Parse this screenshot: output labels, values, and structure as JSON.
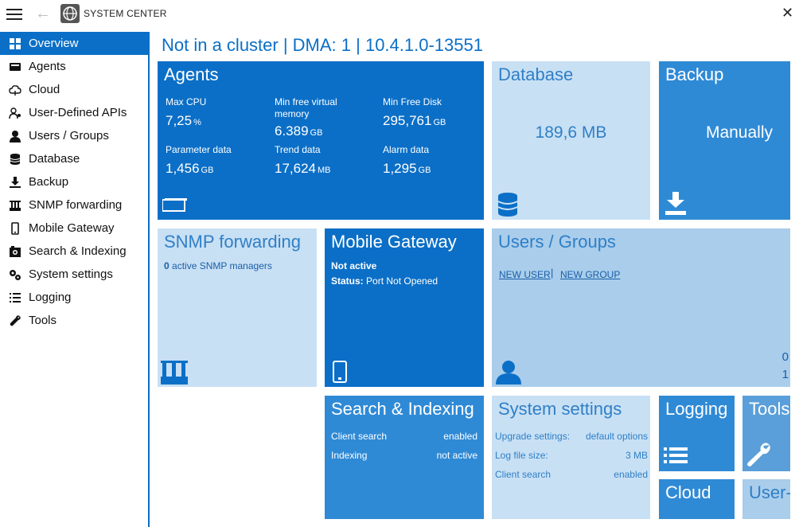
{
  "app": {
    "title": "SYSTEM CENTER"
  },
  "header": {
    "title": "Not in a cluster | DMA: 1 | 10.4.1.0-13551"
  },
  "sidebar": {
    "items": [
      {
        "label": "Overview",
        "icon": "grid-icon"
      },
      {
        "label": "Agents",
        "icon": "agent-icon"
      },
      {
        "label": "Cloud",
        "icon": "cloud-icon"
      },
      {
        "label": "User-Defined APIs",
        "icon": "api-icon"
      },
      {
        "label": "Users / Groups",
        "icon": "user-icon"
      },
      {
        "label": "Database",
        "icon": "database-icon"
      },
      {
        "label": "Backup",
        "icon": "download-icon"
      },
      {
        "label": "SNMP forwarding",
        "icon": "snmp-icon"
      },
      {
        "label": "Mobile Gateway",
        "icon": "phone-icon"
      },
      {
        "label": "Search & Indexing",
        "icon": "search-index-icon"
      },
      {
        "label": "System settings",
        "icon": "gears-icon"
      },
      {
        "label": "Logging",
        "icon": "list-icon"
      },
      {
        "label": "Tools",
        "icon": "wrench-icon"
      }
    ]
  },
  "tiles": {
    "agents": {
      "title": "Agents",
      "max_cpu_label": "Max CPU",
      "max_cpu_value": "7,25",
      "max_cpu_unit": "%",
      "min_vmem_label": "Min free virtual memory",
      "min_vmem_value": "6.389",
      "min_vmem_unit": "GB",
      "min_disk_label": "Min Free Disk",
      "min_disk_value": "295,761",
      "min_disk_unit": "GB",
      "param_label": "Parameter data",
      "param_value": "1,456",
      "param_unit": "GB",
      "trend_label": "Trend data",
      "trend_value": "17,624",
      "trend_unit": "MB",
      "alarm_label": "Alarm data",
      "alarm_value": "1,295",
      "alarm_unit": "GB"
    },
    "database": {
      "title": "Database",
      "value": "189,6 MB"
    },
    "backup": {
      "title": "Backup",
      "value": "Manually"
    },
    "snmp": {
      "title": "SNMP forwarding",
      "count": "0",
      "text": "active SNMP managers"
    },
    "mobile": {
      "title": "Mobile Gateway",
      "state": "Not active",
      "status_label": "Status:",
      "status_value": "Port Not Opened"
    },
    "users": {
      "title": "Users / Groups",
      "new_user": "NEW USER",
      "new_group": "NEW GROUP",
      "count_a": "0",
      "count_b": "1"
    },
    "search": {
      "title": "Search & Indexing",
      "client_label": "Client search",
      "client_value": "enabled",
      "index_label": "Indexing",
      "index_value": "not active"
    },
    "system": {
      "title": "System settings",
      "upgrade_label": "Upgrade settings:",
      "upgrade_value": "default options",
      "logsize_label": "Log file size:",
      "logsize_value": "3 MB",
      "client_label": "Client search",
      "client_value": "enabled"
    },
    "logging": {
      "title": "Logging"
    },
    "tools": {
      "title": "Tools"
    },
    "cloud": {
      "title": "Cloud"
    },
    "userapi": {
      "title": "User-"
    }
  },
  "colors": {
    "accent": "#0b6fc7",
    "mid": "#2f8ad6",
    "pale": "#c8e0f4"
  }
}
